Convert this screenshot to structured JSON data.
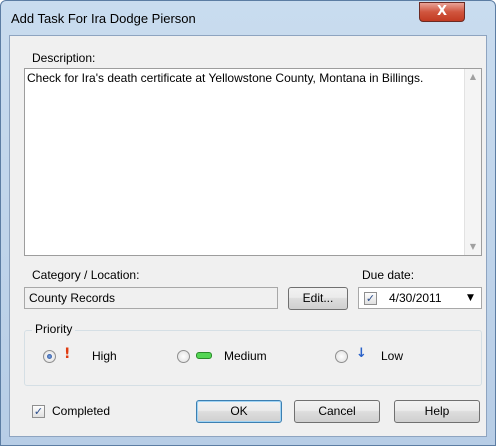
{
  "window": {
    "title": "Add Task For Ira Dodge Pierson",
    "close_glyph": "X"
  },
  "description": {
    "label": "Description:",
    "value": "Check for Ira's death certificate at Yellowstone County, Montana in Billings."
  },
  "category": {
    "label": "Category / Location:",
    "value": "County Records",
    "edit_label": "Edit..."
  },
  "due_date": {
    "label": "Due date:",
    "checked": true,
    "value": "4/30/2011"
  },
  "priority": {
    "title": "Priority",
    "selected": "High",
    "options": [
      {
        "label": "High",
        "icon": "exclamation-icon",
        "color": "#e03b10"
      },
      {
        "label": "Medium",
        "icon": "dash-icon",
        "color": "#3cc23c"
      },
      {
        "label": "Low",
        "icon": "down-arrow-icon",
        "color": "#2a62c9"
      }
    ]
  },
  "completed": {
    "label": "Completed",
    "checked": true
  },
  "buttons": {
    "ok": "OK",
    "cancel": "Cancel",
    "help": "Help"
  }
}
